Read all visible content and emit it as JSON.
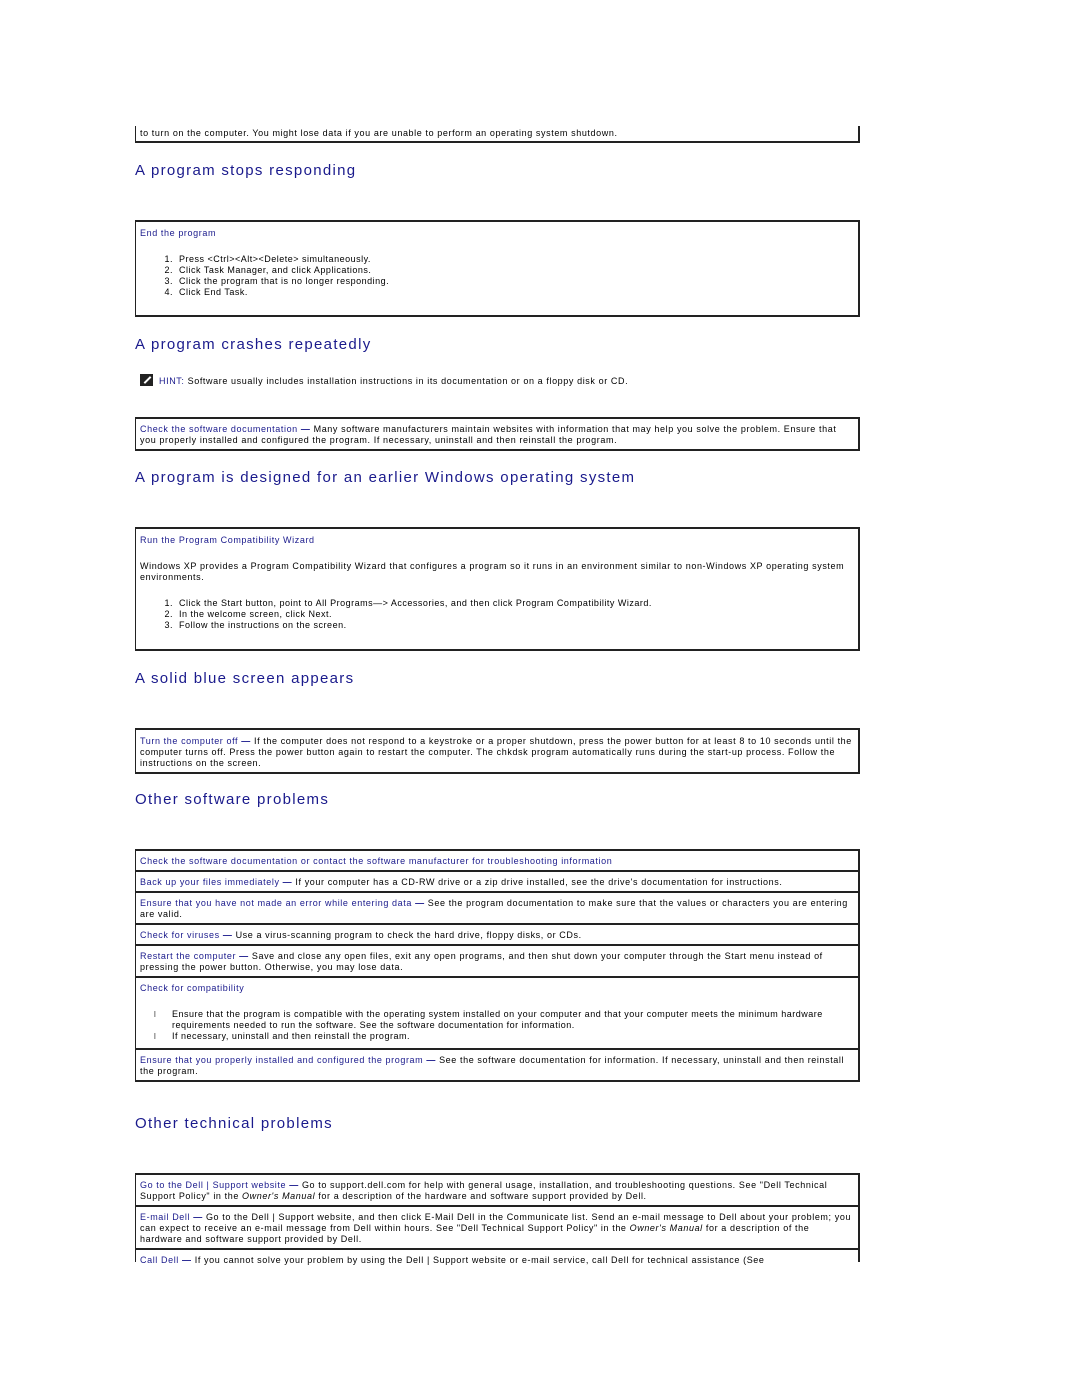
{
  "top_box": {
    "text": "to turn on the computer. You might lose data if you are unable to perform an operating system shutdown."
  },
  "sections": {
    "stops": {
      "title": "A program stops responding",
      "box_heading": "End the program",
      "steps": [
        "Press <Ctrl><Alt><Delete> simultaneously.",
        "Click Task Manager, and click Applications.",
        "Click the program that is no longer responding.",
        "Click End Task."
      ]
    },
    "crashes": {
      "title": "A program crashes repeatedly",
      "hint_label": "HINT:",
      "hint_text": "Software usually includes installation instructions in its documentation or on a floppy disk or CD.",
      "box_link": "Check the software documentation",
      "box_text": "Many software manufacturers maintain websites with information that may help you solve the problem. Ensure that you properly installed and configured the program. If necessary, uninstall and then reinstall the program."
    },
    "earlier": {
      "title": "A program is designed for an earlier Windows operating system",
      "box_heading": "Run the Program Compatibility Wizard",
      "intro": "Windows XP provides a Program Compatibility Wizard that configures a program so it runs in an environment similar to non-Windows XP operating system environments.",
      "steps": [
        "Click the Start button, point to All Programs—> Accessories, and then click Program Compatibility Wizard.",
        "In the welcome screen, click Next.",
        "Follow the instructions on the screen."
      ]
    },
    "bluescreen": {
      "title": "A solid blue screen appears",
      "box_link": "Turn the computer off",
      "box_text": "If the computer does not respond to a keystroke or a proper shutdown, press the power button for at least 8 to 10 seconds until the computer turns off. Press the power button again to restart the computer. The chkdsk program automatically runs during the start-up process. Follow the instructions on the screen."
    },
    "other_sw": {
      "title": "Other software problems",
      "rows": [
        {
          "link": "Check the software documentation or contact the software manufacturer for troubleshooting information",
          "text": ""
        },
        {
          "link": "Back up your files immediately",
          "text": "If your computer has a CD-RW drive or a zip drive installed, see the drive's documentation for instructions."
        },
        {
          "link": "Ensure that you have not made an error while entering data",
          "text": "See the program documentation to make sure that the values or characters you are entering are valid."
        },
        {
          "link": "Check for viruses",
          "text": "Use a virus-scanning program to check the hard drive, floppy disks, or CDs."
        },
        {
          "link": "Restart the computer",
          "text": "Save and close any open files, exit any open programs, and then shut down your computer through the Start menu instead of pressing the power button. Otherwise, you may lose data."
        }
      ],
      "compat": {
        "heading": "Check for compatibility",
        "bullets": [
          "Ensure that the program is compatible with the operating system installed on your computer and that your computer meets the minimum hardware requirements needed to run the software. See the software documentation for information.",
          "If necessary, uninstall and then reinstall the program."
        ]
      },
      "last_row": {
        "link": "Ensure that you properly installed and configured the program",
        "text": "See the software documentation for information. If necessary, uninstall and then reinstall the program."
      }
    },
    "other_tech": {
      "title": "Other technical problems",
      "rows": [
        {
          "link": "Go to the Dell | Support website",
          "text_before": "Go to support.dell.com for help with general usage, installation, and troubleshooting questions. See \"Dell Technical Support Policy\" in the ",
          "italic": "Owner's Manual",
          "text_after": " for a description of the hardware and software support provided by Dell."
        },
        {
          "link": "E-mail Dell",
          "text_before": "Go to the Dell | Support website, and then click E-Mail Dell in the Communicate list. Send an e-mail message to Dell about your problem; you can expect to receive an e-mail message from Dell within hours. See \"Dell Technical Support Policy\" in the ",
          "italic": "Owner's Manual",
          "text_after": " for a description of the hardware and software support provided by Dell."
        },
        {
          "link": "Call Dell",
          "text_before": "If you cannot solve your problem by using the Dell | Support website or e-mail service, call Dell for technical assistance (See",
          "italic": "",
          "text_after": ""
        }
      ]
    }
  },
  "dash": "—"
}
